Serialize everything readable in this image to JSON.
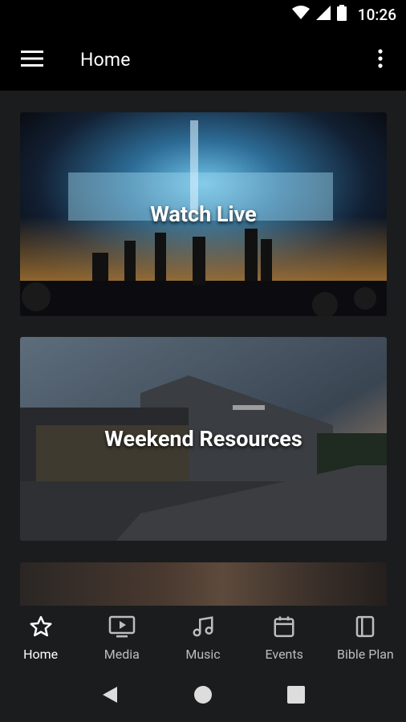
{
  "status_bar": {
    "time": "10:26"
  },
  "app_bar": {
    "title": "Home"
  },
  "cards": [
    {
      "label": "Watch Live"
    },
    {
      "label": "Weekend Resources"
    },
    {
      "label": ""
    }
  ],
  "bottom_nav": [
    {
      "label": "Home",
      "icon": "star-icon",
      "active": true
    },
    {
      "label": "Media",
      "icon": "tv-play-icon",
      "active": false
    },
    {
      "label": "Music",
      "icon": "music-note-icon",
      "active": false
    },
    {
      "label": "Events",
      "icon": "calendar-icon",
      "active": false
    },
    {
      "label": "Bible Plan",
      "icon": "book-icon",
      "active": false
    }
  ],
  "colors": {
    "background": "#1b1c1e",
    "bar": "#000000",
    "active": "#ffffff",
    "inactive": "#bdbdbd"
  }
}
